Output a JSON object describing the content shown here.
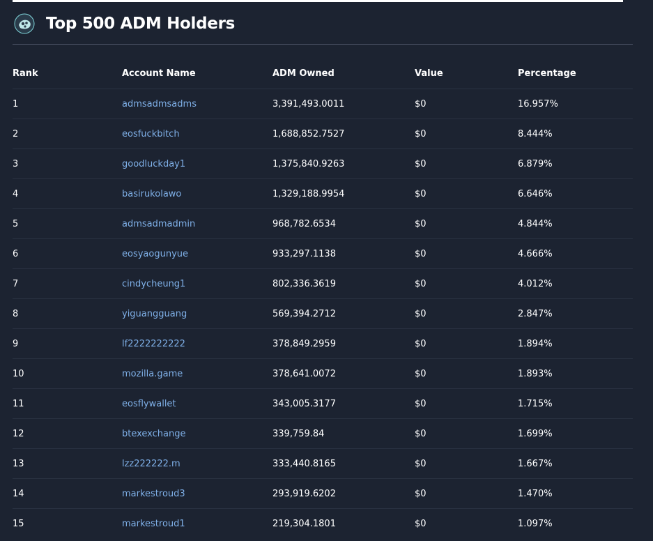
{
  "header": {
    "title": "Top 500 ADM Holders",
    "logo_icon": "adm-token-logo-icon"
  },
  "table": {
    "columns": [
      "Rank",
      "Account Name",
      "ADM Owned",
      "Value",
      "Percentage"
    ],
    "rows": [
      {
        "rank": "1",
        "account": "admsadmsadms",
        "owned": "3,391,493.0011",
        "value": "$0",
        "percentage": "16.957%"
      },
      {
        "rank": "2",
        "account": "eosfuckbitch",
        "owned": "1,688,852.7527",
        "value": "$0",
        "percentage": "8.444%"
      },
      {
        "rank": "3",
        "account": "goodluckday1",
        "owned": "1,375,840.9263",
        "value": "$0",
        "percentage": "6.879%"
      },
      {
        "rank": "4",
        "account": "basirukolawo",
        "owned": "1,329,188.9954",
        "value": "$0",
        "percentage": "6.646%"
      },
      {
        "rank": "5",
        "account": "admsadmadmin",
        "owned": "968,782.6534",
        "value": "$0",
        "percentage": "4.844%"
      },
      {
        "rank": "6",
        "account": "eosyaogunyue",
        "owned": "933,297.1138",
        "value": "$0",
        "percentage": "4.666%"
      },
      {
        "rank": "7",
        "account": "cindycheung1",
        "owned": "802,336.3619",
        "value": "$0",
        "percentage": "4.012%"
      },
      {
        "rank": "8",
        "account": "yiguangguang",
        "owned": "569,394.2712",
        "value": "$0",
        "percentage": "2.847%"
      },
      {
        "rank": "9",
        "account": "lf2222222222",
        "owned": "378,849.2959",
        "value": "$0",
        "percentage": "1.894%"
      },
      {
        "rank": "10",
        "account": "mozilla.game",
        "owned": "378,641.0072",
        "value": "$0",
        "percentage": "1.893%"
      },
      {
        "rank": "11",
        "account": "eosflywallet",
        "owned": "343,005.3177",
        "value": "$0",
        "percentage": "1.715%"
      },
      {
        "rank": "12",
        "account": "btexexchange",
        "owned": "339,759.84",
        "value": "$0",
        "percentage": "1.699%"
      },
      {
        "rank": "13",
        "account": "lzz222222.m",
        "owned": "333,440.8165",
        "value": "$0",
        "percentage": "1.667%"
      },
      {
        "rank": "14",
        "account": "markestroud3",
        "owned": "293,919.6202",
        "value": "$0",
        "percentage": "1.470%"
      },
      {
        "rank": "15",
        "account": "markestroud1",
        "owned": "219,304.1801",
        "value": "$0",
        "percentage": "1.097%"
      }
    ]
  },
  "colors": {
    "background": "#1c2331",
    "link": "#7fb0e8",
    "text": "#ffffff"
  }
}
